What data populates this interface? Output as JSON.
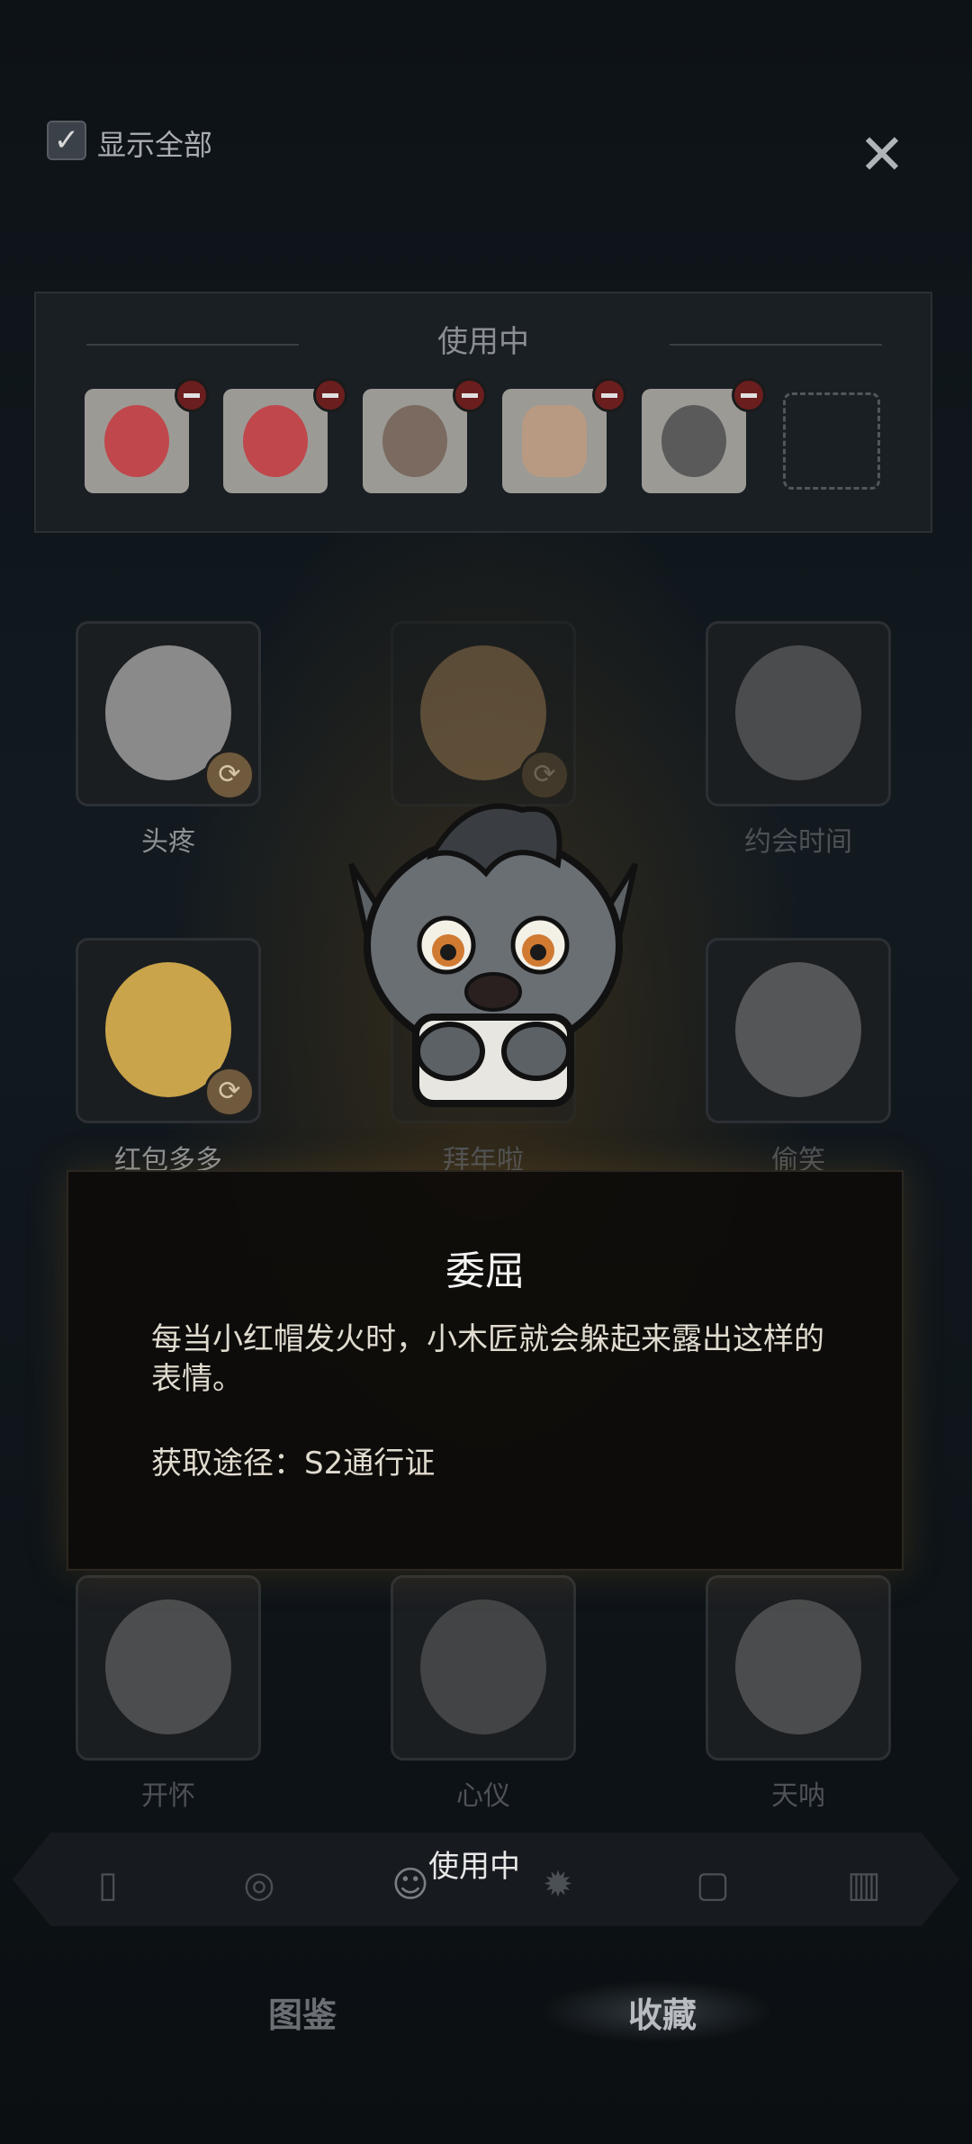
{
  "top": {
    "show_all_label": "显示全部",
    "show_all_checked": true,
    "close_icon": "close-icon"
  },
  "in_use": {
    "title": "使用中",
    "slots": [
      {
        "icon": "red-riding-hood-crying-icon",
        "color": "#c0474c"
      },
      {
        "icon": "red-riding-hood-magnifier-icon",
        "color": "#c0474c"
      },
      {
        "icon": "angry-girl-icon",
        "color": "#7a6a60"
      },
      {
        "icon": "thumbs-up-icon",
        "color": "#b89a82"
      },
      {
        "icon": "sad-wolf-icon",
        "color": "#5a5a5a"
      }
    ]
  },
  "grid": [
    {
      "label": "头疼",
      "dim": false,
      "refresh": true
    },
    {
      "label": "",
      "dim": true,
      "refresh": true
    },
    {
      "label": "约会时间",
      "dim": true,
      "refresh": false
    },
    {
      "label": "红包多多",
      "dim": false,
      "refresh": true
    },
    {
      "label": "拜年啦",
      "dim": true,
      "refresh": false
    },
    {
      "label": "偷笑",
      "dim": true,
      "refresh": false
    },
    {
      "label": "开怀",
      "dim": true,
      "refresh": false
    },
    {
      "label": "心仪",
      "dim": true,
      "refresh": false
    },
    {
      "label": "天呐",
      "dim": true,
      "refresh": false
    }
  ],
  "detail": {
    "title": "委屈",
    "description": "每当小红帽发火时，小木匠就会躲起来露出这样的表情。",
    "source": "获取途径：S2通行证"
  },
  "category_bar": {
    "label": "使用中",
    "icons": [
      "card-icon",
      "portrait-icon",
      "emote-icon",
      "sun-icon",
      "frame-icon",
      "cardback-icon"
    ]
  },
  "tabs": [
    {
      "label": "图鉴",
      "active": false
    },
    {
      "label": "收藏",
      "active": true
    }
  ]
}
